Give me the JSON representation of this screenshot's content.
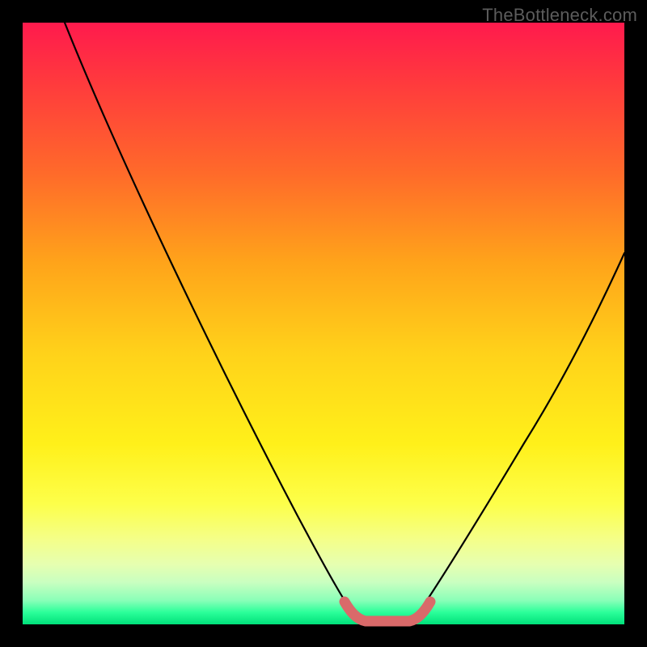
{
  "watermark": "TheBottleneck.com",
  "chart_data": {
    "type": "line",
    "title": "",
    "xlabel": "",
    "ylabel": "",
    "xlim": [
      0,
      100
    ],
    "ylim": [
      0,
      100
    ],
    "grid": false,
    "notes": "Two black curves descending from top-left and top-right into a flat trough near the bottom; trough segment highlighted in coral. No axis ticks or numeric labels are visible.",
    "series": [
      {
        "name": "left-curve",
        "color": "#000000",
        "x": [
          7,
          20,
          35,
          48,
          53,
          55
        ],
        "y": [
          100,
          72,
          40,
          12,
          3,
          1
        ]
      },
      {
        "name": "right-curve",
        "color": "#000000",
        "x": [
          65,
          68,
          74,
          85,
          100
        ],
        "y": [
          1,
          5,
          15,
          35,
          62
        ]
      },
      {
        "name": "trough-highlight",
        "color": "#d96a6a",
        "x": [
          53,
          55,
          57,
          60,
          63,
          65,
          67
        ],
        "y": [
          3.5,
          1.2,
          0.5,
          0.3,
          0.5,
          1.2,
          3.5
        ]
      }
    ]
  }
}
